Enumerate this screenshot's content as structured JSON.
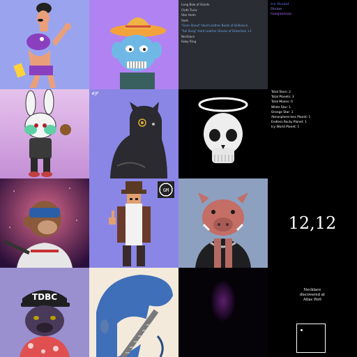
{
  "loot_list": {
    "items": [
      {
        "text": "Long Bow of Giants",
        "rarity": "common"
      },
      {
        "text": "Cloth Tunic",
        "rarity": "common"
      },
      {
        "text": "Star Helm",
        "rarity": "common"
      },
      {
        "text": "Sash",
        "rarity": "common"
      },
      {
        "text": "\"Grim Shout\" Hard Leather Boots of Brilliance",
        "rarity": "rare"
      },
      {
        "text": "\"Sol Song\" Hard Leather Gloves of Detection +1",
        "rarity": "rare"
      },
      {
        "text": "Necklace",
        "rarity": "common"
      },
      {
        "text": "Ruby Ring",
        "rarity": "common"
      }
    ]
  },
  "names_list": {
    "items": [
      {
        "text": "Ice Hound",
        "color": "#5b7bff"
      },
      {
        "text": "Divine",
        "color": "#8d8dff"
      },
      {
        "text": "Gargantuan",
        "color": "#b36bff"
      }
    ]
  },
  "planet_stats": {
    "lines": [
      "Total Stars: 2",
      "Total Planets: 3",
      "Total Moons: 0",
      "White Star: 1",
      "Orange Star: 1",
      "Atmosphere-less Planet: 1",
      "Endless Rocky Planet: 1",
      "Icy World Planet: 1"
    ]
  },
  "coordinates": {
    "text": "12,12"
  },
  "discovery": {
    "line1": "Necklace",
    "line2": "discovered at",
    "line3": "Atlas Port"
  },
  "badges": {
    "pixel_badge": "GM",
    "cap_text": "TDBC",
    "corner_tag": "#JP"
  },
  "colors": {
    "common_text": "#cfd2d6",
    "rare_text": "#6fa6e8",
    "panel_bg": "#2a2d33"
  }
}
